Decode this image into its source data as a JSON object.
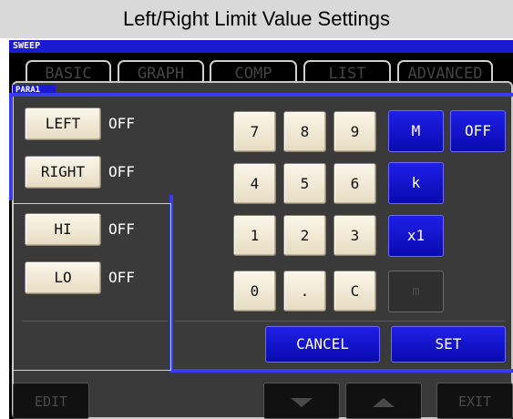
{
  "title": "Left/Right Limit Value Settings",
  "status_label": "SWEEP",
  "tabs": [
    "BASIC",
    "GRAPH",
    "COMP",
    "LIST",
    "ADVANCED"
  ],
  "panel_label": "PARA1",
  "limits": [
    {
      "name": "LEFT",
      "value": "OFF"
    },
    {
      "name": "RIGHT",
      "value": "OFF"
    },
    {
      "name": "HI",
      "value": "OFF"
    },
    {
      "name": "LO",
      "value": "OFF"
    }
  ],
  "keypad": {
    "digits": [
      "7",
      "8",
      "9",
      "4",
      "5",
      "6",
      "1",
      "2",
      "3",
      "0",
      ".",
      "C"
    ],
    "units": [
      "M",
      "k",
      "x1",
      "m"
    ],
    "off_label": "OFF",
    "cancel_label": "CANCEL",
    "set_label": "SET"
  },
  "bottom": {
    "edit_label": "EDIT",
    "exit_label": "EXIT",
    "down_icon": "triangle-down-icon",
    "up_icon": "triangle-up-icon"
  },
  "colors": {
    "accent_blue": "#1a1ad0",
    "highlight": "#3b3bf0",
    "button_cream": "#f2ead5",
    "panel_gray": "#3a3a3a"
  }
}
